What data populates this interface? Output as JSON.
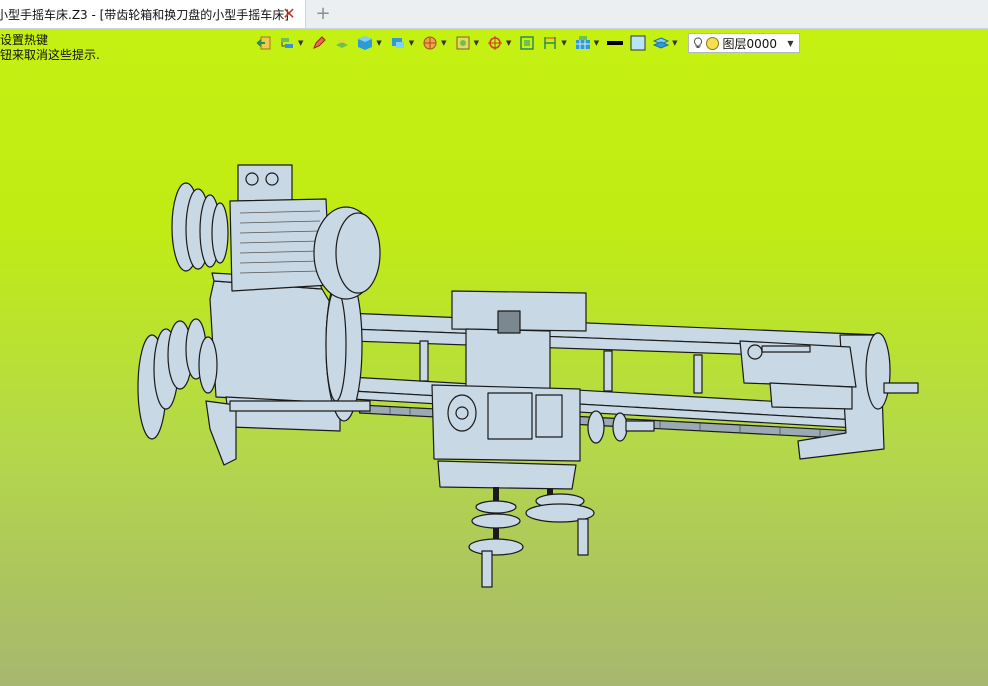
{
  "tab": {
    "title": "小型手摇车床.Z3 - [带齿轮箱和换刀盘的小型手摇车床]",
    "close_glyph": "✕",
    "new_tab_glyph": "+"
  },
  "hint": {
    "line1": "设置热键",
    "line2": "钮来取消这些提示."
  },
  "toolbar": {
    "icons": [
      "exit-sketch-icon",
      "feature-tree-icon",
      "pen-icon",
      "extrude-icon",
      "cube-view-icon",
      "display-mode-icon",
      "render-style-icon",
      "section-view-icon",
      "snap-target-icon",
      "fit-view-icon",
      "dimension-icon",
      "grid-icon",
      "line-color-icon",
      "fill-color-icon",
      "layer-stack-icon"
    ],
    "layer_name": "图层0000",
    "line_color": "#000000",
    "fill_color": "#b8e4f7"
  },
  "colors": {
    "viewport_top": "#c4f012",
    "viewport_bottom": "#a7b76f",
    "model_fill": "#c8d8e4",
    "model_outline": "#1a1a1a"
  }
}
